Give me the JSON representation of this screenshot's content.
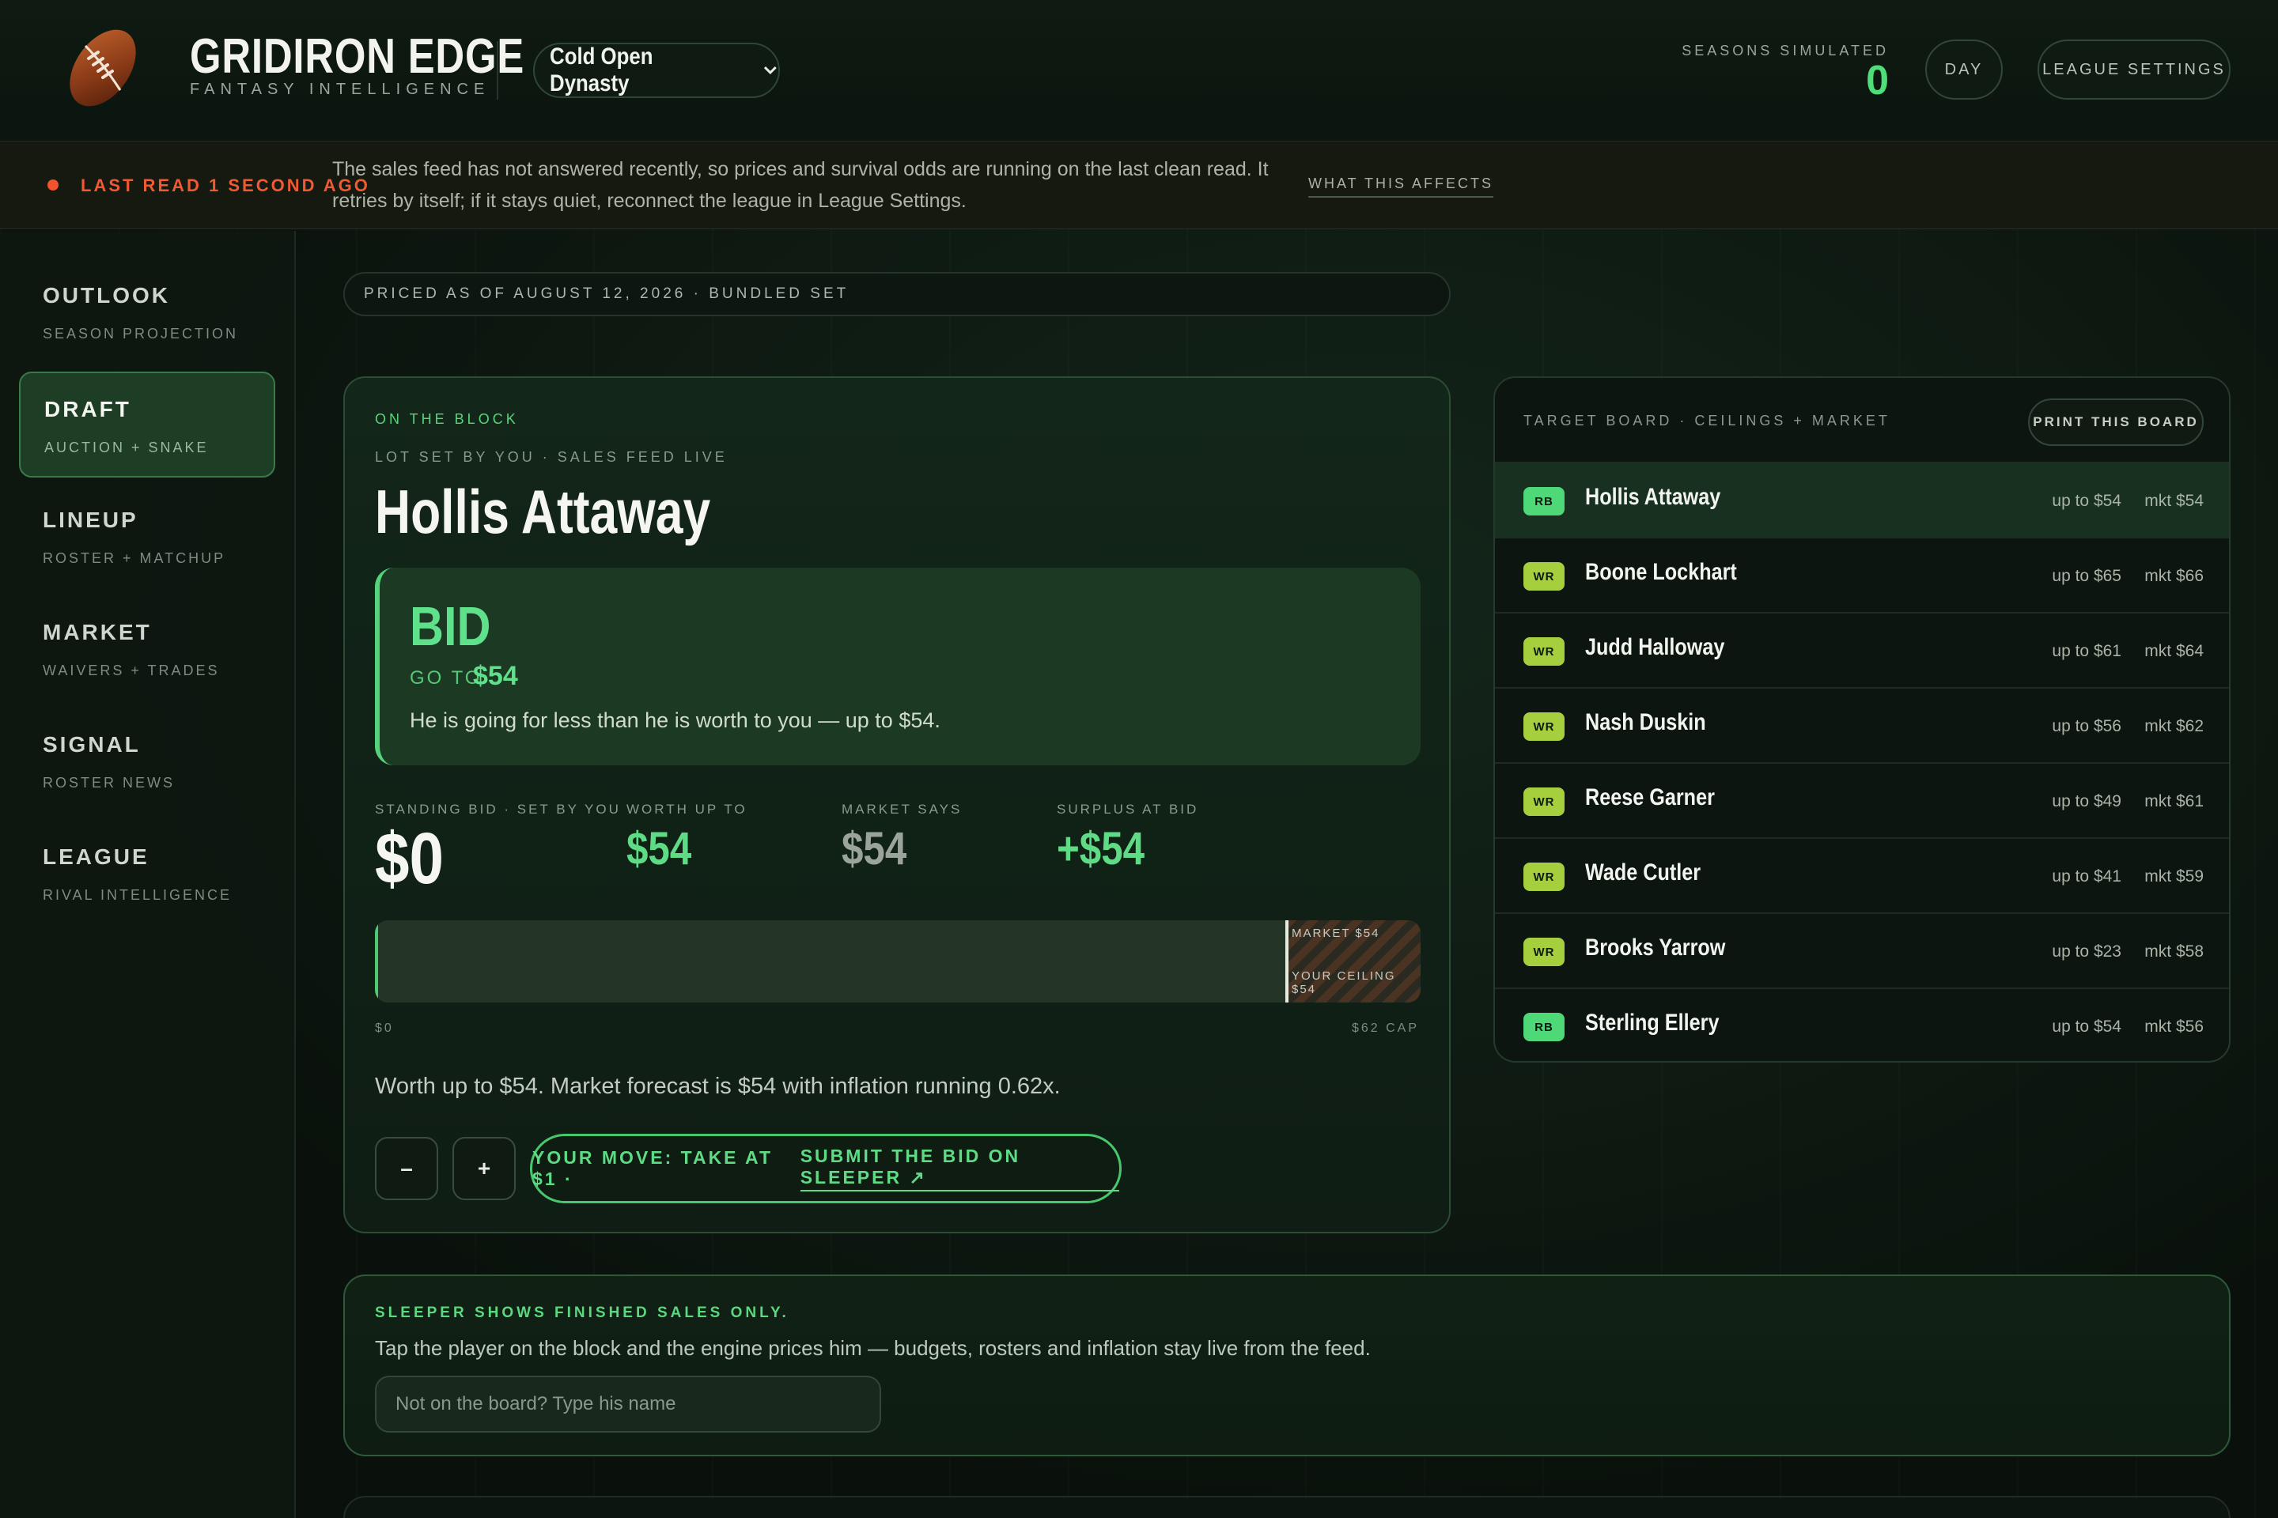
{
  "header": {
    "title": "GRIDIRON EDGE",
    "subtitle": "FANTASY INTELLIGENCE",
    "league": "Cold Open Dynasty",
    "seasons_label": "SEASONS SIMULATED",
    "seasons_value": "0",
    "day_label": "DAY",
    "settings_label": "LEAGUE SETTINGS"
  },
  "alert": {
    "label": "LAST READ 1 SECOND AGO",
    "text": "The sales feed has not answered recently, so prices and survival odds are running on the last clean read. It retries by itself; if it stays quiet, reconnect the league in League Settings.",
    "link": "WHAT THIS AFFECTS"
  },
  "sidebar": {
    "items": [
      {
        "title": "OUTLOOK",
        "sub": "SEASON PROJECTION"
      },
      {
        "title": "DRAFT",
        "sub": "AUCTION + SNAKE"
      },
      {
        "title": "LINEUP",
        "sub": "ROSTER + MATCHUP"
      },
      {
        "title": "MARKET",
        "sub": "WAIVERS + TRADES"
      },
      {
        "title": "SIGNAL",
        "sub": "ROSTER NEWS"
      },
      {
        "title": "LEAGUE",
        "sub": "RIVAL INTELLIGENCE"
      }
    ]
  },
  "priced": "PRICED AS OF AUGUST 12, 2026 · BUNDLED SET",
  "block": {
    "label": "ON THE BLOCK",
    "sublabel": "LOT SET BY YOU · SALES FEED LIVE",
    "player": "Hollis Attaway",
    "bid_word": "BID",
    "goto_label": "GO TO",
    "goto_value": "$54",
    "bid_desc": "He is going for less than he is worth to you — up to $54.",
    "stats": [
      {
        "label": "STANDING BID · SET BY YOU",
        "value": "$0"
      },
      {
        "label": "WORTH UP TO",
        "value": "$54"
      },
      {
        "label": "MARKET SAYS",
        "value": "$54"
      },
      {
        "label": "SURPLUS AT BID",
        "value": "+$54"
      }
    ],
    "range": {
      "min_label": "$0",
      "max_label": "$62 CAP",
      "market_label": "MARKET $54",
      "ceiling_label": "YOUR CEILING $54",
      "min": 0,
      "max": 62,
      "market": 54,
      "standing": 0
    },
    "worth_text": "Worth up to $54. Market forecast is $54 with inflation running 0.62x.",
    "minus": "–",
    "plus": "+",
    "move_text": "YOUR MOVE: TAKE AT $1 ·",
    "move_link": "SUBMIT THE BID ON SLEEPER ↗"
  },
  "board": {
    "title": "TARGET BOARD · CEILINGS + MARKET",
    "print_label": "PRINT THIS BOARD",
    "rows": [
      {
        "pos": "RB",
        "name": "Hollis Attaway",
        "ceiling": "up to $54",
        "market": "mkt $54"
      },
      {
        "pos": "WR",
        "name": "Boone Lockhart",
        "ceiling": "up to $65",
        "market": "mkt $66"
      },
      {
        "pos": "WR",
        "name": "Judd Halloway",
        "ceiling": "up to $61",
        "market": "mkt $64"
      },
      {
        "pos": "WR",
        "name": "Nash Duskin",
        "ceiling": "up to $56",
        "market": "mkt $62"
      },
      {
        "pos": "WR",
        "name": "Reese Garner",
        "ceiling": "up to $49",
        "market": "mkt $61"
      },
      {
        "pos": "WR",
        "name": "Wade Cutler",
        "ceiling": "up to $41",
        "market": "mkt $59"
      },
      {
        "pos": "WR",
        "name": "Brooks Yarrow",
        "ceiling": "up to $23",
        "market": "mkt $58"
      },
      {
        "pos": "RB",
        "name": "Sterling Ellery",
        "ceiling": "up to $54",
        "market": "mkt $56"
      }
    ]
  },
  "sleeper": {
    "label": "SLEEPER SHOWS FINISHED SALES ONLY.",
    "desc": "Tap the player on the block and the engine prices him — budgets, rosters and inflation stay live from the feed.",
    "placeholder": "Not on the board? Type his name"
  },
  "colors": {
    "accent": "#5fdb85",
    "alert": "#ef5a33",
    "rb_badge": "#4ed878",
    "wr_badge": "#a6cf3e"
  }
}
